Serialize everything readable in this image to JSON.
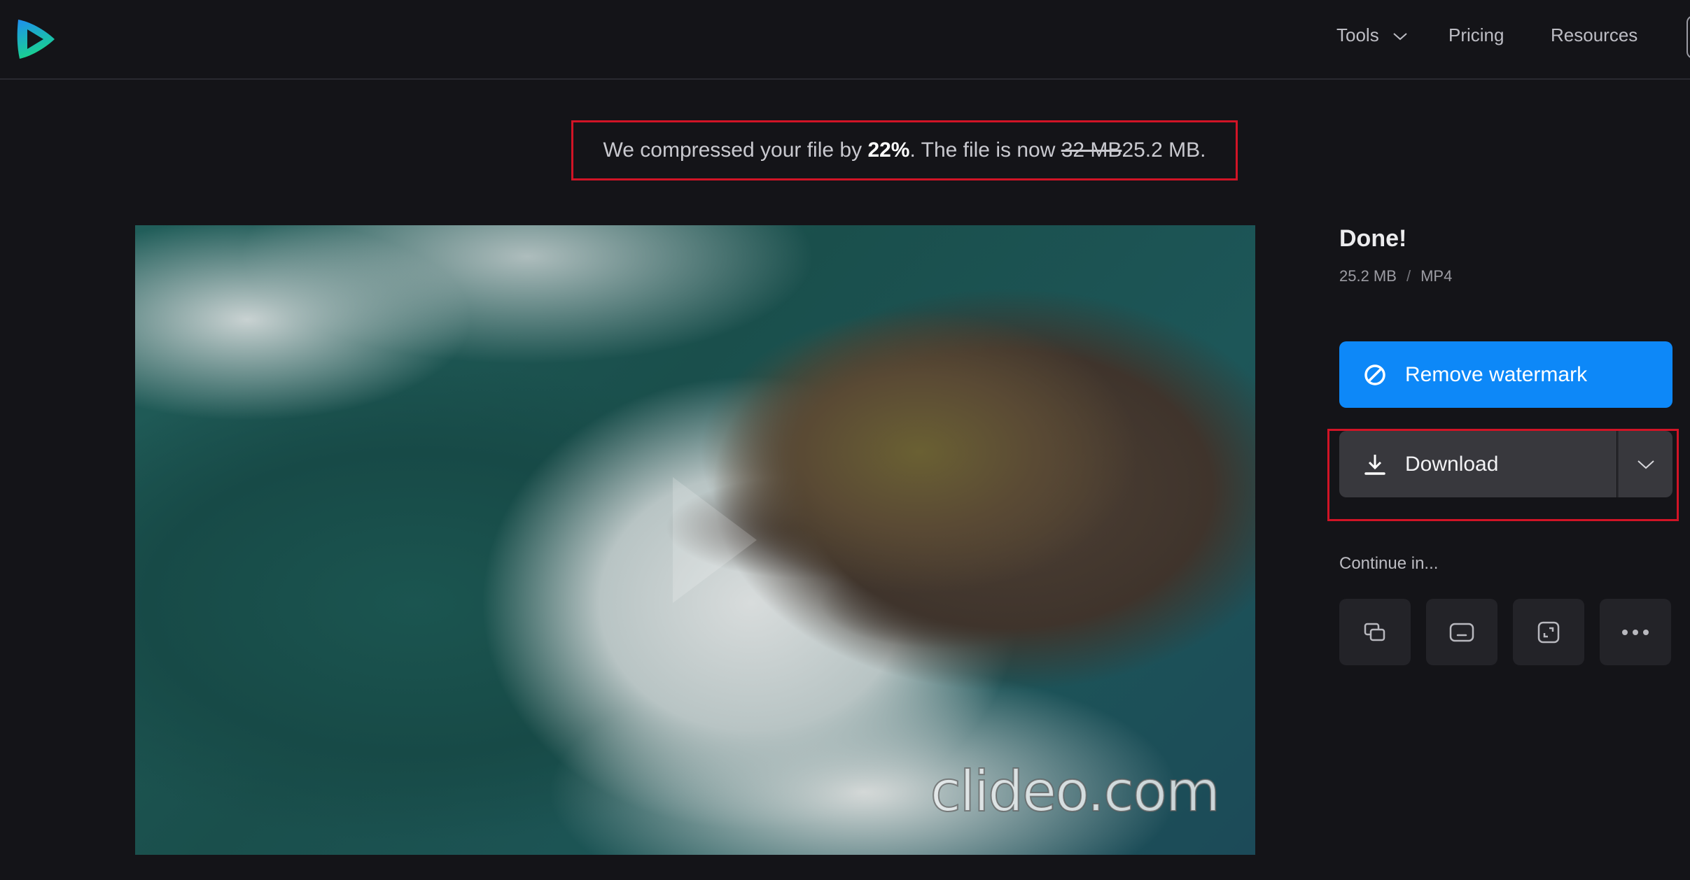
{
  "nav": {
    "logo": "clideo-logo-icon",
    "items": [
      {
        "label": "Tools",
        "icon": "chevron-down-icon"
      },
      {
        "label": "Pricing"
      },
      {
        "label": "Resources"
      }
    ]
  },
  "banner": {
    "prefix": "We compressed your file by ",
    "percent": "22%",
    "middle": ". The file is now ",
    "old_size": "32 MB",
    "new_size": " 25.2 MB.",
    "highlight_color": "#d11426"
  },
  "video": {
    "watermark": "clideo.com",
    "play_icon": "play-icon"
  },
  "panel": {
    "title": "Done!",
    "size": "25.2 MB",
    "separator": "/",
    "format": "MP4",
    "remove_watermark_label": "Remove watermark",
    "remove_watermark_icon": "prohibited-icon",
    "download_label": "Download",
    "download_icon": "download-icon",
    "download_more_icon": "chevron-down-icon",
    "continue_label": "Continue in...",
    "continue_tools": [
      {
        "icon": "merge-icon"
      },
      {
        "icon": "subtitles-icon"
      },
      {
        "icon": "resize-icon"
      },
      {
        "icon": "more-icon"
      }
    ],
    "accent_color": "#0d88f8"
  }
}
